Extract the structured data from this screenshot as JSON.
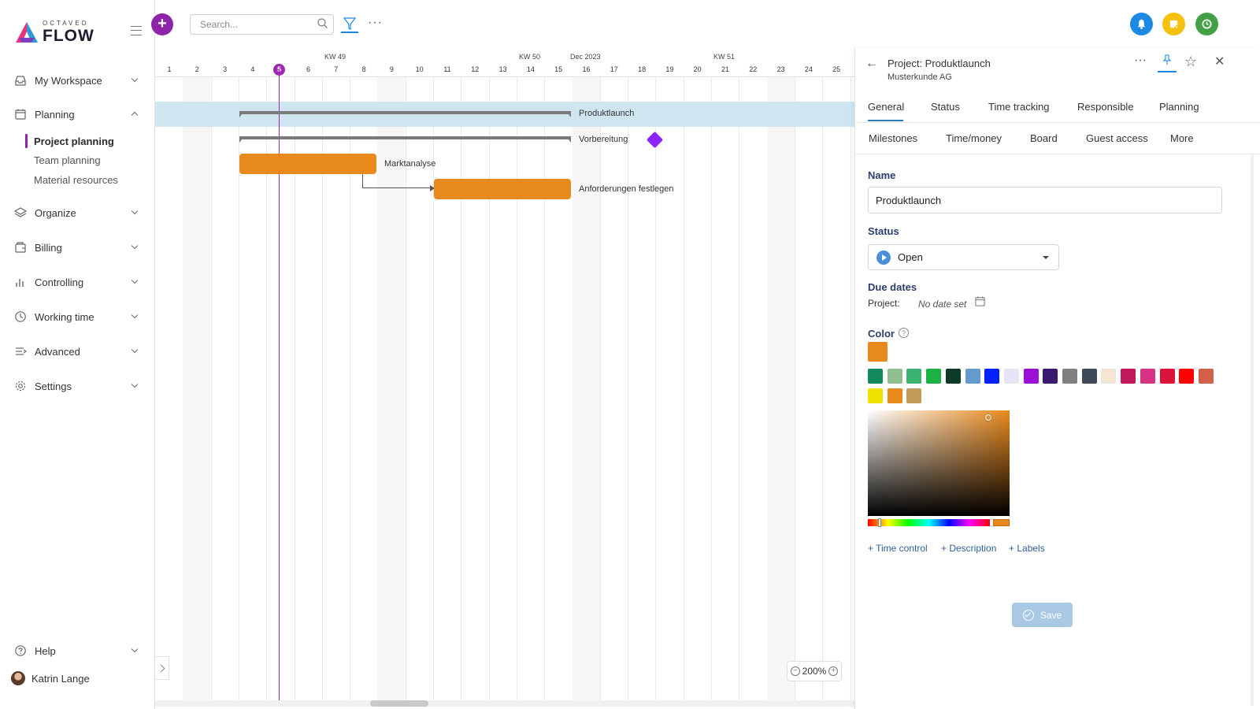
{
  "app": {
    "logo_small": "OCTAVED",
    "logo_big": "FLOW"
  },
  "sidebar": {
    "items": [
      {
        "label": "My Workspace",
        "icon": "inbox-icon"
      },
      {
        "label": "Planning",
        "icon": "calendar-icon"
      },
      {
        "label": "Organize",
        "icon": "layers-icon"
      },
      {
        "label": "Billing",
        "icon": "wallet-icon"
      },
      {
        "label": "Controlling",
        "icon": "bar-chart-icon"
      },
      {
        "label": "Working time",
        "icon": "clock-icon"
      },
      {
        "label": "Advanced",
        "icon": "sliders-icon"
      },
      {
        "label": "Settings",
        "icon": "gear-icon"
      }
    ],
    "planning_sub": [
      {
        "label": "Project planning",
        "active": true
      },
      {
        "label": "Team planning"
      },
      {
        "label": "Material resources"
      }
    ],
    "help": "Help",
    "user": "Katrin Lange"
  },
  "topbar": {
    "search_placeholder": "Search...",
    "colors": {
      "bell": "#1e88e5",
      "note": "#f4c20d",
      "clock": "#43a047",
      "accent": "#8e24aa"
    }
  },
  "gantt": {
    "week_labels": [
      "KW 49",
      "KW 50",
      "Dec 2023",
      "KW 51"
    ],
    "days": [
      "1",
      "2",
      "3",
      "4",
      "5",
      "6",
      "7",
      "8",
      "9",
      "10",
      "11",
      "12",
      "13",
      "14",
      "15",
      "16",
      "17",
      "18",
      "19",
      "20",
      "21",
      "22",
      "23",
      "24",
      "25"
    ],
    "today": "5",
    "tasks": [
      "Produktlaunch",
      "Vorbereitung",
      "Marktanalyse",
      "Anforderungen festlegen"
    ],
    "zoom": "200%"
  },
  "panel": {
    "title": "Project: Produktlaunch",
    "subtitle": "Musterkunde AG",
    "tabs_row1": [
      "General",
      "Status",
      "Time tracking",
      "Responsible",
      "Planning"
    ],
    "tabs_row2": [
      "Milestones",
      "Time/money",
      "Board",
      "Guest access",
      "More"
    ],
    "name_label": "Name",
    "name_value": "Produktlaunch",
    "status_label": "Status",
    "status_value": "Open",
    "due_label": "Due dates",
    "due_project_label": "Project:",
    "due_project_value": "No date set",
    "color_label": "Color",
    "current_color": "#e8891c",
    "palette": [
      "#138a5e",
      "#8fbf8f",
      "#3cb371",
      "#1db045",
      "#0d3b27",
      "#6699cc",
      "#0022ff",
      "#e8e4f8",
      "#9b10d6",
      "#3a1a6e",
      "#808080",
      "#3e4a59",
      "#f5e6d3",
      "#c0195a",
      "#d63384",
      "#dc143c",
      "#ff0000",
      "#d2604a",
      "#f0e000",
      "#e8891c",
      "#c49a5a"
    ],
    "links": [
      "+ Time control",
      "+ Description",
      "+ Labels"
    ],
    "save_label": "Save"
  }
}
